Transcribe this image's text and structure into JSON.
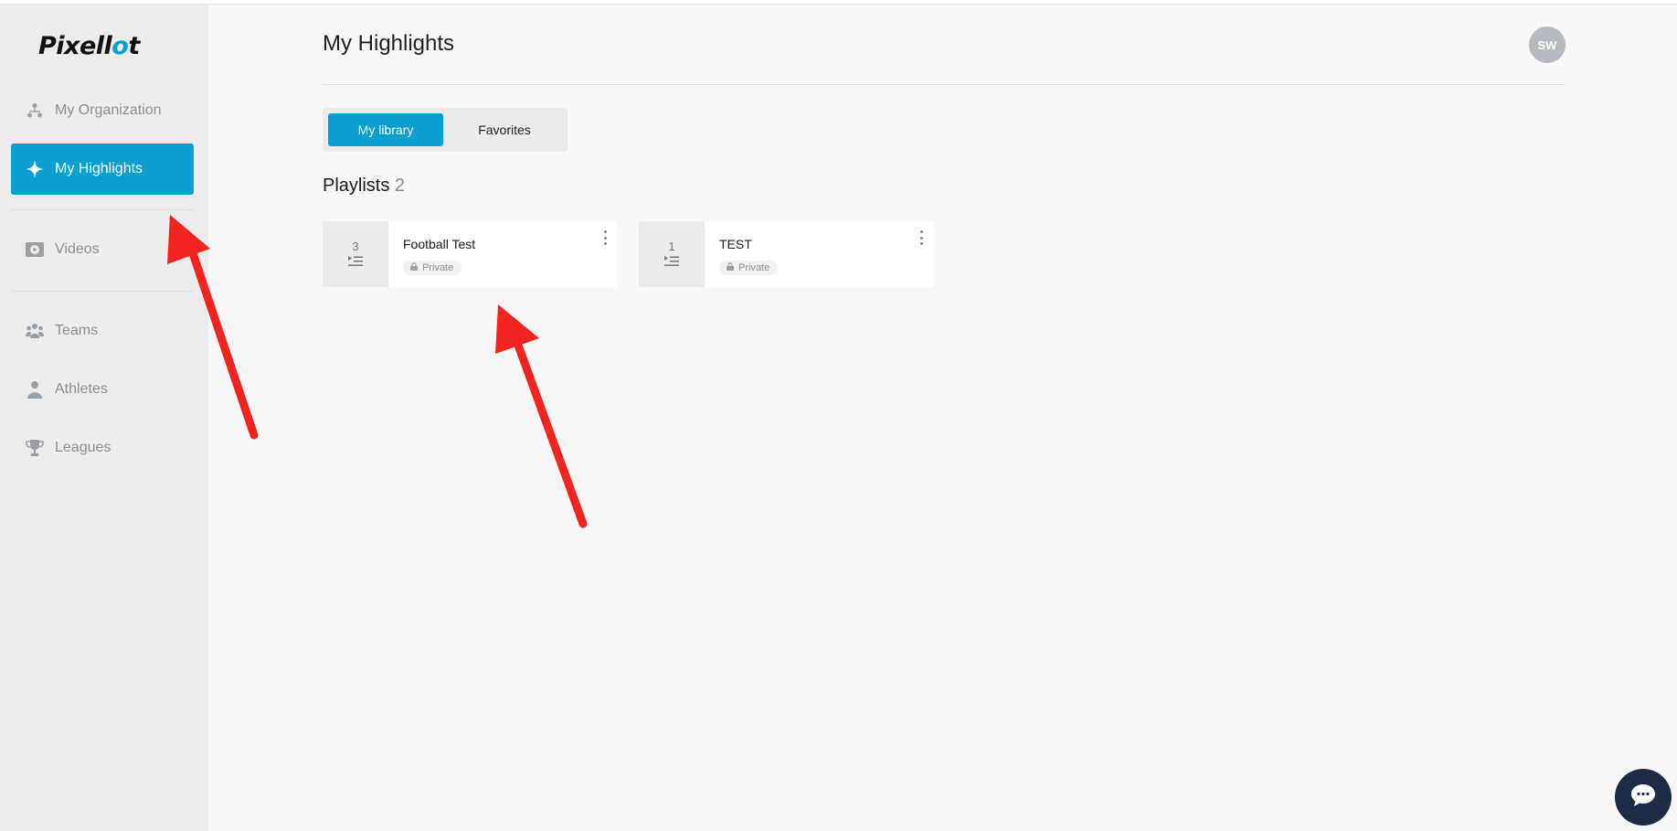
{
  "app": {
    "logo": "Pixellot"
  },
  "sidebar": {
    "items": [
      {
        "label": "My Organization",
        "icon": "organization-icon"
      },
      {
        "label": "My Highlights",
        "icon": "sparkle-icon",
        "active": true
      },
      {
        "label": "Videos",
        "icon": "play-icon"
      },
      {
        "label": "Teams",
        "icon": "teams-icon"
      },
      {
        "label": "Athletes",
        "icon": "athlete-icon"
      },
      {
        "label": "Leagues",
        "icon": "trophy-icon"
      }
    ]
  },
  "header": {
    "title": "My Highlights",
    "avatar_initials": "SW"
  },
  "tabs": [
    {
      "label": "My library",
      "active": true
    },
    {
      "label": "Favorites",
      "active": false
    }
  ],
  "playlists": {
    "title": "Playlists",
    "count": "2",
    "items": [
      {
        "name": "Football Test",
        "count": "3",
        "visibility": "Private"
      },
      {
        "name": "TEST",
        "count": "1",
        "visibility": "Private"
      }
    ]
  },
  "colors": {
    "accent": "#0a9fd0",
    "arrow": "#f2241f",
    "chat": "#1d2b45"
  }
}
